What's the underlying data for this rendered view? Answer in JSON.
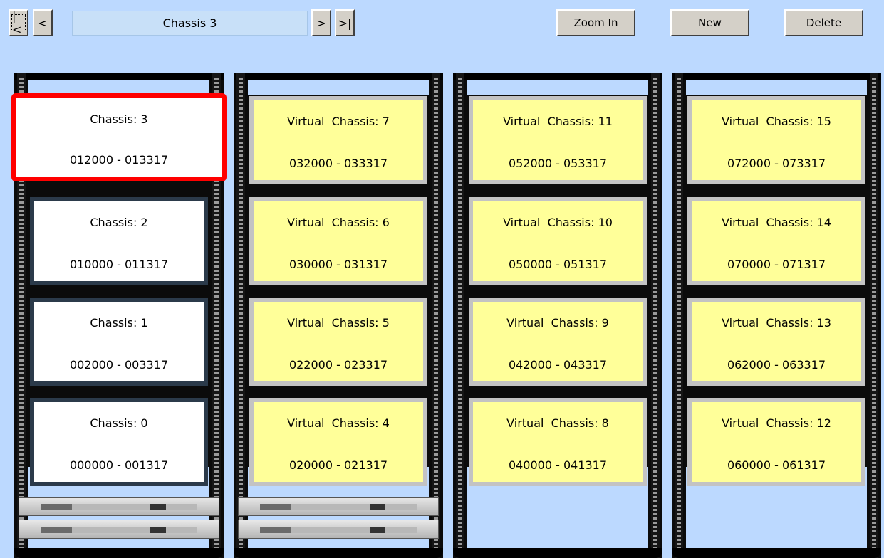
{
  "toolbar": {
    "first_label": "|<",
    "prev_label": "<",
    "title": "Chassis 3",
    "next_label": ">",
    "last_label": ">|",
    "zoom_in_label": "Zoom In",
    "new_label": "New",
    "delete_label": "Delete"
  },
  "racks": [
    {
      "slots": [
        {
          "name": "Chassis: 3",
          "range": "012000 - 013317",
          "selected": true
        },
        {
          "name": "Chassis: 2",
          "range": "010000 - 011317"
        },
        {
          "name": "Chassis: 1",
          "range": "002000 - 003317"
        },
        {
          "name": "Chassis: 0",
          "range": "000000 - 001317"
        }
      ]
    },
    {
      "slots": [
        {
          "name": "Virtual  Chassis: 7",
          "range": "032000 - 033317"
        },
        {
          "name": "Virtual  Chassis: 6",
          "range": "030000 - 031317"
        },
        {
          "name": "Virtual  Chassis: 5",
          "range": "022000 - 023317"
        },
        {
          "name": "Virtual  Chassis: 4",
          "range": "020000 - 021317"
        }
      ]
    },
    {
      "slots": [
        {
          "name": "Virtual  Chassis: 11",
          "range": "052000 - 053317"
        },
        {
          "name": "Virtual  Chassis: 10",
          "range": "050000 - 051317"
        },
        {
          "name": "Virtual  Chassis: 9",
          "range": "042000 - 043317"
        },
        {
          "name": "Virtual  Chassis: 8",
          "range": "040000 - 041317"
        }
      ]
    },
    {
      "slots": [
        {
          "name": "Virtual  Chassis: 15",
          "range": "072000 - 073317"
        },
        {
          "name": "Virtual  Chassis: 14",
          "range": "070000 - 071317"
        },
        {
          "name": "Virtual  Chassis: 13",
          "range": "062000 - 063317"
        },
        {
          "name": "Virtual  Chassis: 12",
          "range": "060000 - 061317"
        }
      ]
    }
  ]
}
